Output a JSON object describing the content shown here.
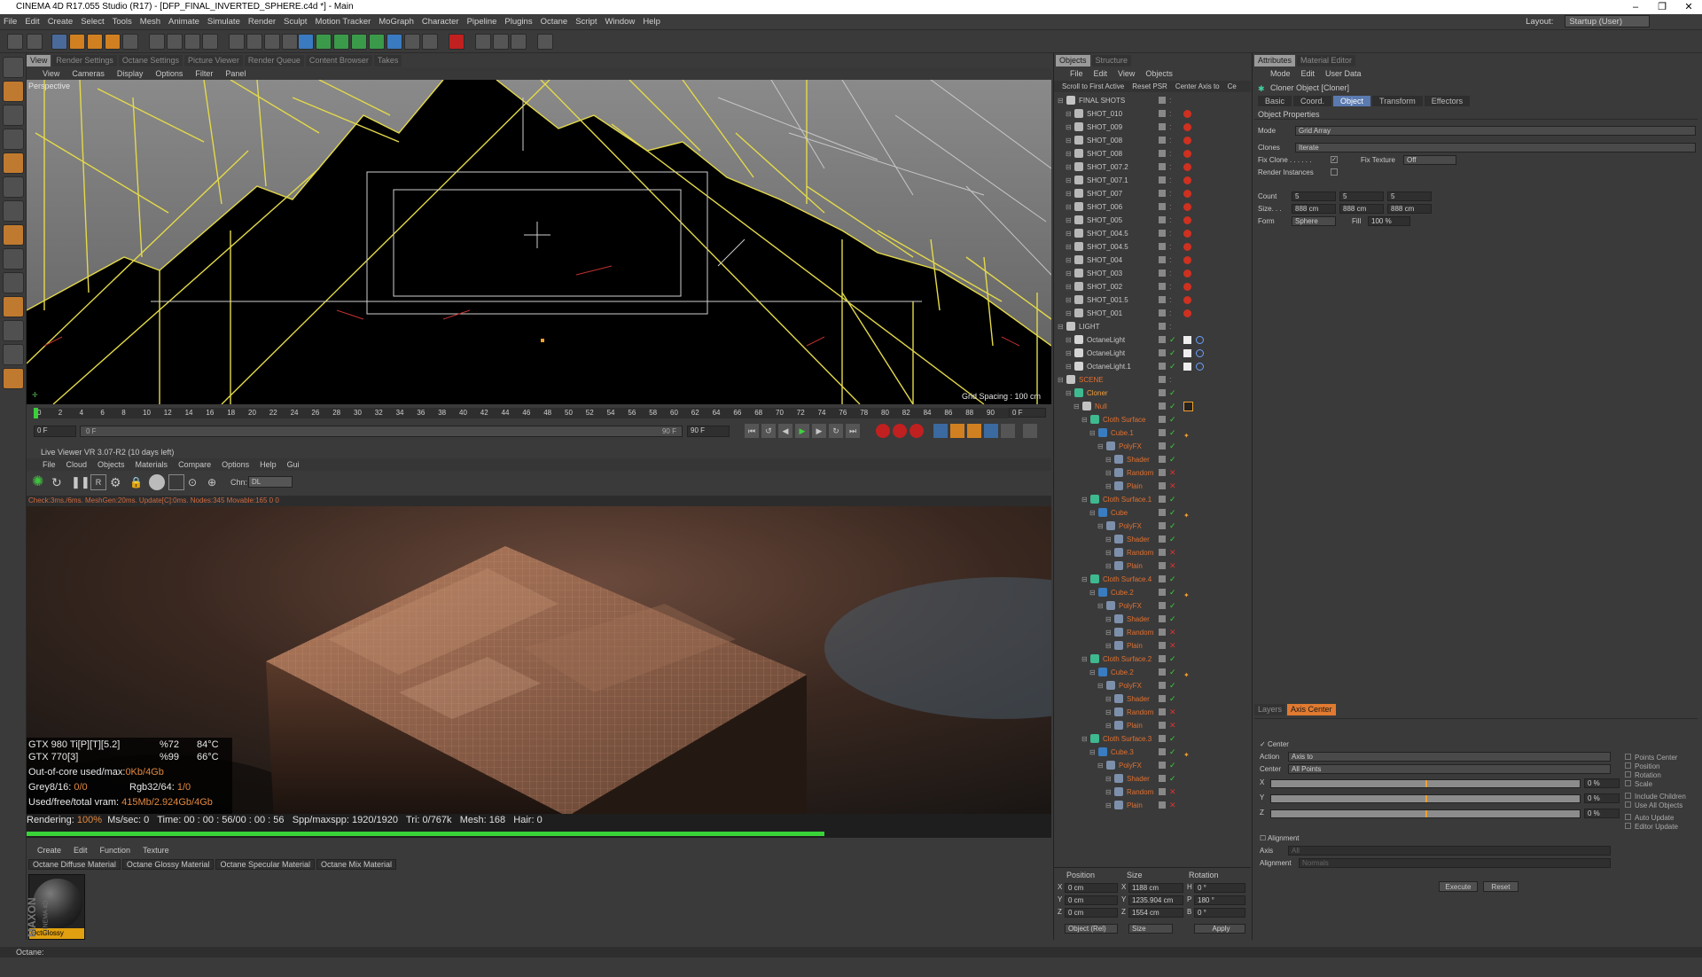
{
  "window": {
    "title": "CINEMA 4D R17.055 Studio (R17) - [DFP_FINAL_INVERTED_SPHERE.c4d *] - Main",
    "controls": [
      "–",
      "❐",
      "✕"
    ]
  },
  "menubar": {
    "items": [
      "File",
      "Edit",
      "Create",
      "Select",
      "Tools",
      "Mesh",
      "Animate",
      "Simulate",
      "Render",
      "Sculpt",
      "Motion Tracker",
      "MoGraph",
      "Character",
      "Pipeline",
      "Plugins",
      "Octane",
      "Script",
      "Window",
      "Help"
    ],
    "layout_label": "Layout:",
    "layout_value": "Startup (User)"
  },
  "viewport_tabs": [
    "View",
    "Render Settings",
    "Octane Settings",
    "Picture Viewer",
    "Render Queue",
    "Content Browser",
    "Takes"
  ],
  "viewport": {
    "menu": [
      "View",
      "Cameras",
      "Display",
      "Options",
      "Filter",
      "Panel"
    ],
    "label": "Perspective",
    "grid_spacing": "Grid Spacing : 100 cm"
  },
  "timeline": {
    "ticks": [
      "0",
      "2",
      "4",
      "6",
      "8",
      "10",
      "12",
      "14",
      "16",
      "18",
      "20",
      "22",
      "24",
      "26",
      "28",
      "30",
      "32",
      "34",
      "36",
      "38",
      "40",
      "42",
      "44",
      "46",
      "48",
      "50",
      "52",
      "54",
      "56",
      "58",
      "60",
      "62",
      "64",
      "66",
      "68",
      "70",
      "72",
      "74",
      "76",
      "78",
      "80",
      "82",
      "84",
      "86",
      "88",
      "90"
    ],
    "current_frame": "0 F",
    "start_frame": "0 F",
    "slider_start": "0 F",
    "slider_end": "90 F",
    "end_frame": "90 F"
  },
  "live_viewer": {
    "title": "Live Viewer VR 3.07-R2 (10 days left)",
    "menu": [
      "File",
      "Cloud",
      "Objects",
      "Materials",
      "Compare",
      "Options",
      "Help",
      "Gui"
    ],
    "channel_label": "Chn:",
    "channel_value": "DL",
    "status": "Check:3ms./6ms. MeshGen:20ms. Update[C]:0ms. Nodes:345 Movable:165  0 0",
    "hud": {
      "gpu1_name": "GTX 980 Ti[P][T][5.2]",
      "gpu1_load": "%72",
      "gpu1_temp": "84°C",
      "gpu2_name": "GTX 770[3]",
      "gpu2_load": "%99",
      "gpu2_temp": "66°C",
      "ooc_label": "Out-of-core used/max:",
      "ooc_value": "0Kb/4Gb",
      "grey_label": "Grey8/16: ",
      "grey_value": "0/0",
      "rgb_label": "Rgb32/64: ",
      "rgb_value": "1/0",
      "vram_label": "Used/free/total vram: ",
      "vram_value": "415Mb/2.924Gb/4Gb"
    },
    "render": {
      "label": "Rendering:",
      "percent": "100%",
      "ms_label": "Ms/sec:",
      "ms": "0",
      "time_label": "Time:",
      "time": "00 : 00 : 56/00 : 00 : 56",
      "spp_label": "Spp/maxspp:",
      "spp": "1920/1920",
      "tri_label": "Tri:",
      "tri": "0/767k",
      "mesh_label": "Mesh:",
      "mesh": "168",
      "hair_label": "Hair:",
      "hair": "0",
      "progress": 1.0
    }
  },
  "material_manager": {
    "menu": [
      "Create",
      "Edit",
      "Function",
      "Texture"
    ],
    "tabs": [
      "Octane Diffuse Material",
      "Octane Glossy Material",
      "Octane Specular Material",
      "Octane Mix Material"
    ],
    "material_name": "OctGlossy",
    "logo_maxon": "MAXON",
    "logo_c4d": "CINEMA 4D"
  },
  "objects_panel": {
    "tabs": [
      "Objects",
      "Structure"
    ],
    "menu": [
      "File",
      "Edit",
      "View",
      "Objects"
    ],
    "buttons": [
      "Scroll to First Active",
      "Reset PSR",
      "Center Axis to",
      "Ce"
    ],
    "rows": [
      {
        "name": "FINAL SHOTS",
        "indent": 0,
        "color": "#c8c8c8"
      },
      {
        "name": "SHOT_010",
        "indent": 1,
        "color": "#c8c8c8"
      },
      {
        "name": "SHOT_009",
        "indent": 1,
        "color": "#c8c8c8"
      },
      {
        "name": "SHOT_008",
        "indent": 1,
        "color": "#c8c8c8"
      },
      {
        "name": "SHOT_008",
        "indent": 1,
        "color": "#c8c8c8"
      },
      {
        "name": "SHOT_007.2",
        "indent": 1,
        "color": "#c8c8c8"
      },
      {
        "name": "SHOT_007.1",
        "indent": 1,
        "color": "#c8c8c8"
      },
      {
        "name": "SHOT_007",
        "indent": 1,
        "color": "#c8c8c8"
      },
      {
        "name": "SHOT_006",
        "indent": 1,
        "color": "#c8c8c8"
      },
      {
        "name": "SHOT_005",
        "indent": 1,
        "color": "#c8c8c8"
      },
      {
        "name": "SHOT_004.5",
        "indent": 1,
        "color": "#c8c8c8"
      },
      {
        "name": "SHOT_004.5",
        "indent": 1,
        "color": "#c8c8c8"
      },
      {
        "name": "SHOT_004",
        "indent": 1,
        "color": "#c8c8c8"
      },
      {
        "name": "SHOT_003",
        "indent": 1,
        "color": "#c8c8c8"
      },
      {
        "name": "SHOT_002",
        "indent": 1,
        "color": "#c8c8c8"
      },
      {
        "name": "SHOT_001.5",
        "indent": 1,
        "color": "#c8c8c8"
      },
      {
        "name": "SHOT_001",
        "indent": 1,
        "color": "#c8c8c8"
      },
      {
        "name": "LIGHT",
        "indent": 0,
        "color": "#c8c8c8"
      },
      {
        "name": "OctaneLight",
        "indent": 1,
        "color": "#c8c8c8"
      },
      {
        "name": "OctaneLight",
        "indent": 1,
        "color": "#c8c8c8"
      },
      {
        "name": "OctaneLight.1",
        "indent": 1,
        "color": "#c8c8c8"
      },
      {
        "name": "SCENE",
        "indent": 0,
        "color": "#e07030"
      },
      {
        "name": "Cloner",
        "indent": 1,
        "color": "#f0a040"
      },
      {
        "name": "Null",
        "indent": 2,
        "color": "#e07030"
      },
      {
        "name": "Cloth Surface",
        "indent": 3,
        "color": "#e07030"
      },
      {
        "name": "Cube.1",
        "indent": 4,
        "color": "#e07030"
      },
      {
        "name": "PolyFX",
        "indent": 5,
        "color": "#e07030"
      },
      {
        "name": "Shader",
        "indent": 6,
        "color": "#e07030"
      },
      {
        "name": "Random",
        "indent": 6,
        "color": "#e07030"
      },
      {
        "name": "Plain",
        "indent": 6,
        "color": "#e07030"
      },
      {
        "name": "Cloth Surface.1",
        "indent": 3,
        "color": "#e07030"
      },
      {
        "name": "Cube",
        "indent": 4,
        "color": "#e07030"
      },
      {
        "name": "PolyFX",
        "indent": 5,
        "color": "#e07030"
      },
      {
        "name": "Shader",
        "indent": 6,
        "color": "#e07030"
      },
      {
        "name": "Random",
        "indent": 6,
        "color": "#e07030"
      },
      {
        "name": "Plain",
        "indent": 6,
        "color": "#e07030"
      },
      {
        "name": "Cloth Surface.4",
        "indent": 3,
        "color": "#e07030"
      },
      {
        "name": "Cube.2",
        "indent": 4,
        "color": "#e07030"
      },
      {
        "name": "PolyFX",
        "indent": 5,
        "color": "#e07030"
      },
      {
        "name": "Shader",
        "indent": 6,
        "color": "#e07030"
      },
      {
        "name": "Random",
        "indent": 6,
        "color": "#e07030"
      },
      {
        "name": "Plain",
        "indent": 6,
        "color": "#e07030"
      },
      {
        "name": "Cloth Surface.2",
        "indent": 3,
        "color": "#e07030"
      },
      {
        "name": "Cube.2",
        "indent": 4,
        "color": "#e07030"
      },
      {
        "name": "PolyFX",
        "indent": 5,
        "color": "#e07030"
      },
      {
        "name": "Shader",
        "indent": 6,
        "color": "#e07030"
      },
      {
        "name": "Random",
        "indent": 6,
        "color": "#e07030"
      },
      {
        "name": "Plain",
        "indent": 6,
        "color": "#e07030"
      },
      {
        "name": "Cloth Surface.3",
        "indent": 3,
        "color": "#e07030"
      },
      {
        "name": "Cube.3",
        "indent": 4,
        "color": "#e07030"
      },
      {
        "name": "PolyFX",
        "indent": 5,
        "color": "#e07030"
      },
      {
        "name": "Shader",
        "indent": 6,
        "color": "#e07030"
      },
      {
        "name": "Random",
        "indent": 6,
        "color": "#e07030"
      },
      {
        "name": "Plain",
        "indent": 6,
        "color": "#e07030"
      }
    ]
  },
  "coordinates": {
    "headers": [
      "Position",
      "Size",
      "Rotation"
    ],
    "rows": [
      {
        "axis": "X",
        "pos": "0 cm",
        "size_axis": "X",
        "size": "1188 cm",
        "rot_axis": "H",
        "rot": "0 °"
      },
      {
        "axis": "Y",
        "pos": "0 cm",
        "size_axis": "Y",
        "size": "1235.904 cm",
        "rot_axis": "P",
        "rot": "180 °"
      },
      {
        "axis": "Z",
        "pos": "0 cm",
        "size_axis": "Z",
        "size": "1554 cm",
        "rot_axis": "B",
        "rot": "0 °"
      }
    ],
    "mode1": "Object (Rel)",
    "mode2": "Size",
    "apply": "Apply"
  },
  "attributes": {
    "tabs": [
      "Attributes",
      "Material Editor"
    ],
    "menu": [
      "Mode",
      "Edit",
      "User Data"
    ],
    "object_title": "Cloner Object [Cloner]",
    "subtabs": [
      "Basic",
      "Coord.",
      "Object",
      "Transform",
      "Effectors"
    ],
    "section": "Object Properties",
    "mode_label": "Mode",
    "mode_value": "Grid Array",
    "clones_label": "Clones",
    "clones_value": "Iterate",
    "fix_clone_label": "Fix Clone . . . . . .",
    "fix_texture_label": "Fix Texture",
    "fix_texture_value": "Off",
    "render_instances_label": "Render Instances",
    "count_label": "Count",
    "count_values": [
      "5",
      "5",
      "5"
    ],
    "size_label": "Size. . .",
    "size_values": [
      "888 cm",
      "888 cm",
      "888 cm"
    ],
    "form_label": "Form",
    "form_value": "Sphere",
    "fill_label": "Fill",
    "fill_value": "100 %"
  },
  "axis_center": {
    "tabs": [
      "Layers",
      "Axis Center"
    ],
    "center_label": "Center",
    "action_label": "Action",
    "action_value": "Axis to",
    "center2_label": "Center",
    "center2_value": "All Points",
    "sliders": [
      {
        "axis": "X",
        "value": "0 %"
      },
      {
        "axis": "Y",
        "value": "0 %"
      },
      {
        "axis": "Z",
        "value": "0 %"
      }
    ],
    "right_options": [
      "Points Center",
      "Position",
      "Rotation",
      "Scale",
      "Include Children",
      "Use All Objects",
      "Auto Update",
      "Editor Update"
    ],
    "alignment_check": "Alignment",
    "axis_label": "Axis",
    "axis_value": "All",
    "alignment_label": "Alignment",
    "alignment_value": "Normals",
    "execute": "Execute",
    "reset": "Reset"
  },
  "status_bar": "Octane:"
}
